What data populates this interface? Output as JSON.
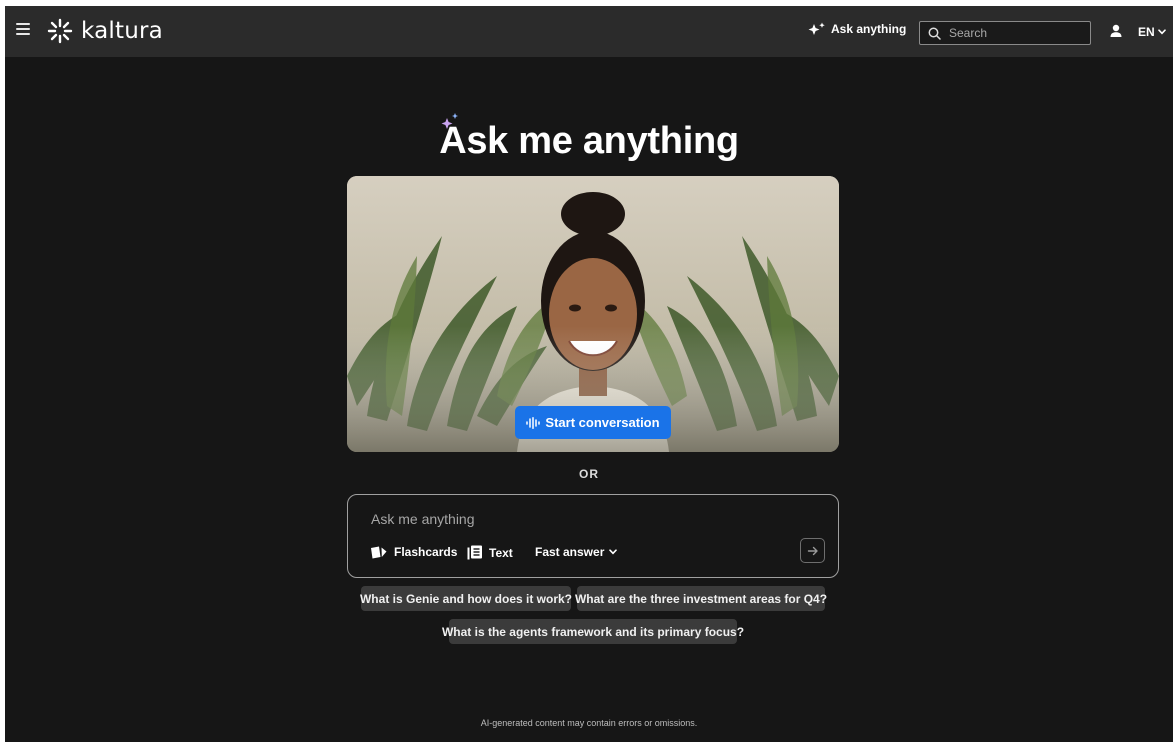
{
  "header": {
    "brand": "kaltura",
    "ask_label": "Ask anything",
    "search_placeholder": "Search",
    "language": "EN"
  },
  "main": {
    "title": "Ask me anything",
    "start_conversation_label": "Start conversation",
    "or_label": "OR",
    "ask_placeholder": "Ask me anything",
    "tools": {
      "flashcards": "Flashcards",
      "text": "Text",
      "mode": "Fast answer"
    },
    "suggestions": [
      "What is Genie and how does it work?",
      "What are the three investment areas for Q4?",
      "What is the agents framework and its primary focus?"
    ],
    "disclaimer": "AI-generated content may contain errors or omissions."
  },
  "colors": {
    "header_bg": "#2b2b2b",
    "page_bg": "#161616",
    "accent_blue": "#1a73e8",
    "chip_bg": "#3b3b3b"
  },
  "icons": [
    "menu-icon",
    "kaltura-logo-icon",
    "sparkle-icon",
    "search-icon",
    "user-icon",
    "chevron-down-icon",
    "audio-wave-icon",
    "flashcards-icon",
    "text-document-icon",
    "arrow-right-icon"
  ]
}
